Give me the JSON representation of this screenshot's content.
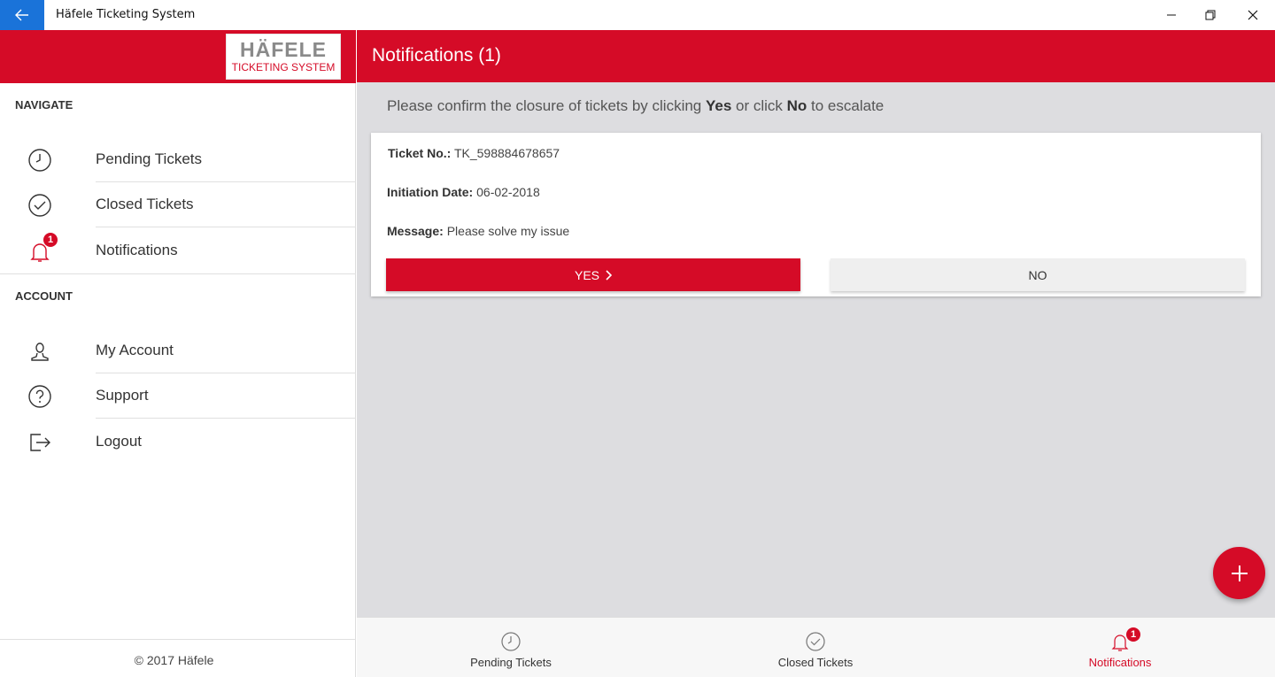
{
  "window": {
    "title": "Häfele Ticketing System"
  },
  "brand": {
    "logo_main": "HÄFELE",
    "logo_sub": "TICKETING SYSTEM",
    "accent_color": "#d50b27"
  },
  "sidebar": {
    "navigate_label": "NAVIGATE",
    "nav_items": [
      {
        "label": "Pending Tickets",
        "icon": "clock-icon"
      },
      {
        "label": "Closed Tickets",
        "icon": "check-circle-icon"
      },
      {
        "label": "Notifications",
        "icon": "bell-icon",
        "badge": "1"
      }
    ],
    "account_label": "ACCOUNT",
    "account_items": [
      {
        "label": "My Account",
        "icon": "user-icon"
      },
      {
        "label": "Support",
        "icon": "question-icon"
      },
      {
        "label": "Logout",
        "icon": "logout-icon"
      }
    ],
    "footer": "© 2017 Häfele"
  },
  "main": {
    "title": "Notifications (1)",
    "instruction": {
      "prefix": "Please confirm the closure of tickets by clicking ",
      "yes": "Yes",
      "middle": " or click ",
      "no": "No",
      "suffix": " to escalate"
    },
    "ticket": {
      "ticket_no_label": "Ticket No.:",
      "ticket_no": "TK_598884678657",
      "date_label": "Initiation Date:",
      "date": "06-02-2018",
      "message_label": "Message:",
      "message": "Please solve my issue"
    },
    "yes_button": "YES",
    "no_button": "NO"
  },
  "bottom_tabs": [
    {
      "label": "Pending Tickets",
      "icon": "clock-icon"
    },
    {
      "label": "Closed Tickets",
      "icon": "check-circle-icon"
    },
    {
      "label": "Notifications",
      "icon": "bell-icon",
      "badge": "1",
      "active": true
    }
  ]
}
